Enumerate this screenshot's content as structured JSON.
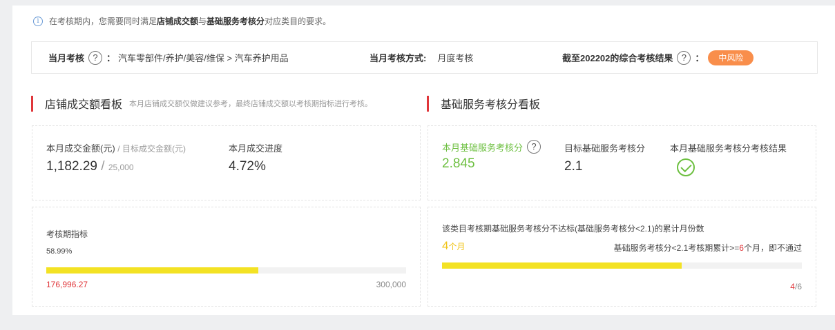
{
  "notice": {
    "prefix": "在考核期内，您需要同时满足",
    "bold1": "店铺成交额",
    "mid": "与",
    "bold2": "基础服务考核分",
    "suffix": "对应类目的要求。"
  },
  "assess_bar": {
    "month_label": "当月考核",
    "colon": "：",
    "category_path": "汽车零部件/养护/美容/维保 > 汽车养护用品",
    "method_label": "当月考核方式:",
    "method_value": "月度考核",
    "result_label": "截至202202的综合考核结果",
    "result_colon": "：",
    "risk_badge": "中风险"
  },
  "shop_section": {
    "title": "店铺成交额看板",
    "subtitle": "本月店铺成交额仅做建议参考，最终店铺成交额以考核期指标进行考核。",
    "gmv_label": "本月成交金额(元)",
    "gmv_target_label": "/ 目标成交金额(元)",
    "gmv_value": "1,182.29",
    "gmv_sep": "/",
    "gmv_target": "25,000",
    "progress_label": "本月成交进度",
    "progress_value": "4.72%",
    "period_label": "考核期指标",
    "period_percent": "58.99%",
    "period_progress": 0.5899,
    "period_current": "176,996.27",
    "period_target": "300,000"
  },
  "service_section": {
    "title": "基础服务考核分看板",
    "score_label": "本月基础服务考核分",
    "score_value": "2.845",
    "target_label": "目标基础服务考核分",
    "target_value": "2.1",
    "result_label": "本月基础服务考核分考核结果",
    "fail_title": "该类目考核期基础服务考核分不达标(基础服务考核分<2.1)的累计月份数",
    "fail_count": "4",
    "fail_unit": "个月",
    "rule_prefix": "基础服务考核分<2.1考核期累计>=",
    "rule_count": "6",
    "rule_suffix": "个月，即不通过",
    "fail_progress": 0.6667,
    "fail_current": "4",
    "fail_total": "/6"
  },
  "colors": {
    "accent_red": "#e0363a",
    "green": "#6cbf3f",
    "progress_yellow": "#f3e224",
    "risk_orange": "#f98e4b"
  }
}
